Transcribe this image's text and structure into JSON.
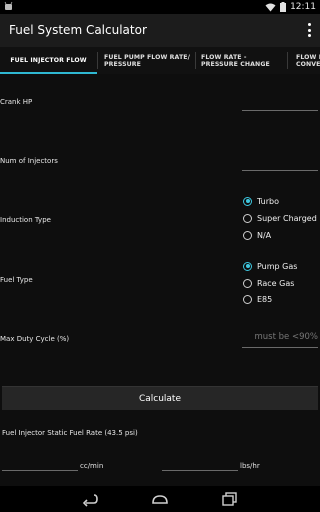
{
  "status_bar": {
    "time": "12:11",
    "icons": [
      "android-notification-icon",
      "wifi-icon",
      "battery-icon"
    ]
  },
  "action_bar": {
    "title": "Fuel System Calculator",
    "overflow_icon": "overflow-menu-icon"
  },
  "tabs": [
    {
      "label": "FUEL INJECTOR FLOW",
      "active": true
    },
    {
      "label": "FUEL PUMP FLOW RATE/ PRESSURE",
      "active": false
    },
    {
      "label": "FLOW RATE - PRESSURE CHANGE",
      "active": false
    },
    {
      "label": "FLOW R... CONVE...",
      "active": false
    }
  ],
  "form": {
    "crank_hp_label": "Crank HP",
    "crank_hp_value": "",
    "num_injectors_label": "Num of Injectors",
    "num_injectors_value": "",
    "induction_label": "Induction Type",
    "induction_options": [
      {
        "label": "Turbo",
        "checked": true
      },
      {
        "label": "Super Charged",
        "checked": false
      },
      {
        "label": "N/A",
        "checked": false
      }
    ],
    "fuel_type_label": "Fuel Type",
    "fuel_type_options": [
      {
        "label": "Pump Gas",
        "checked": true
      },
      {
        "label": "Race Gas",
        "checked": false
      },
      {
        "label": "E85",
        "checked": false
      }
    ],
    "duty_cycle_label": "Max Duty Cycle (%)",
    "duty_cycle_placeholder": "must be <90%",
    "calculate_label": "Calculate"
  },
  "results": {
    "heading": "Fuel Injector Static Fuel Rate (43.5 psi)",
    "cc_value": "",
    "cc_unit": "cc/min",
    "lbs_value": "",
    "lbs_unit": "lbs/hr"
  },
  "nav_bar": {
    "icons": [
      "back-icon",
      "home-icon",
      "recent-apps-icon"
    ]
  },
  "colors": {
    "accent": "#3ec8e0",
    "tab_indicator": "#2fb8d2",
    "background": "#0e0e0e",
    "action_bar": "#1c1c1c"
  }
}
